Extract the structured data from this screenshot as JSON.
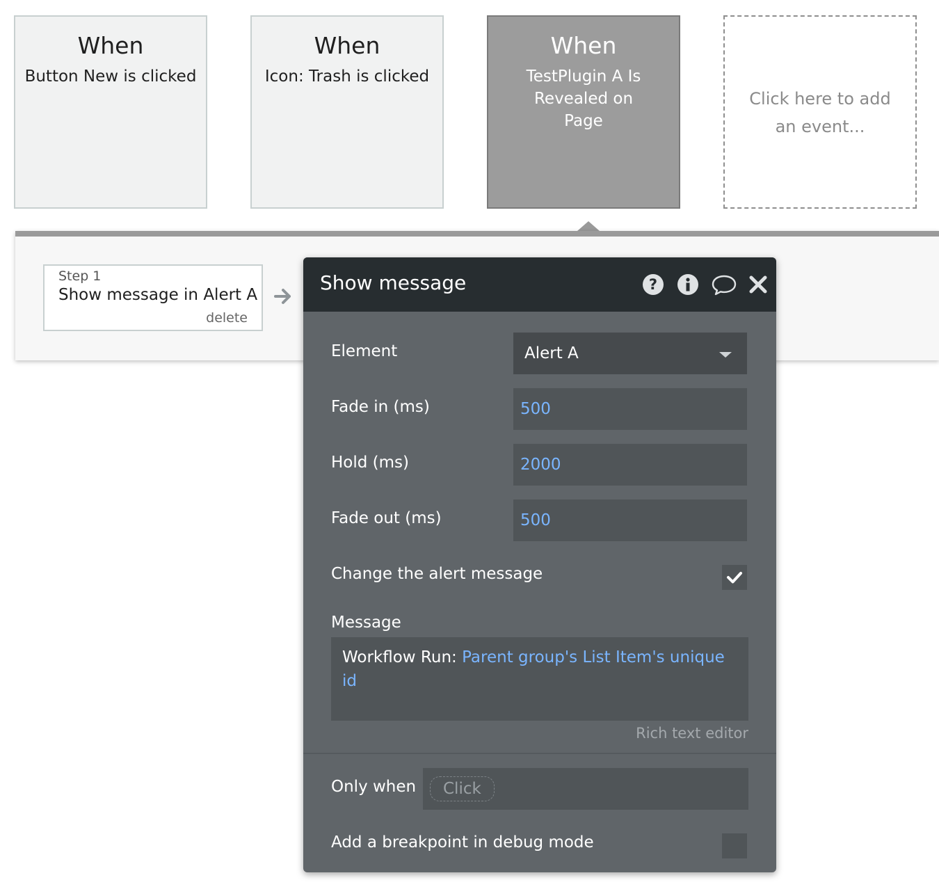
{
  "events": [
    {
      "when": "When",
      "description": "Button New is clicked"
    },
    {
      "when": "When",
      "description": "Icon: Trash is clicked"
    },
    {
      "when": "When",
      "description": "TestPlugin A Is Revealed on Page",
      "selected": true
    }
  ],
  "add_event_text": "Click here to add an event...",
  "step": {
    "number_label": "Step 1",
    "title": "Show message in Alert A",
    "delete_label": "delete"
  },
  "icons": {
    "step_arrow": "arrow-right-icon",
    "help": "question-circle-icon",
    "info": "info-circle-icon",
    "comment": "speech-bubble-icon",
    "close": "close-icon",
    "dropdown": "caret-down-icon",
    "check": "checkmark-icon"
  },
  "panel": {
    "title": "Show message",
    "element": {
      "label": "Element",
      "value": "Alert A"
    },
    "fade_in": {
      "label": "Fade in (ms)",
      "value": "500"
    },
    "hold": {
      "label": "Hold (ms)",
      "value": "2000"
    },
    "fade_out": {
      "label": "Fade out (ms)",
      "value": "500"
    },
    "change_alert": {
      "label": "Change the alert message",
      "checked": true
    },
    "message": {
      "label": "Message",
      "static_text": "Workflow Run: ",
      "dynamic_text": "Parent group's List Item's unique id"
    },
    "rich_text_link": "Rich text editor",
    "only_when": {
      "label": "Only when",
      "placeholder": "Click"
    },
    "breakpoint": {
      "label": "Add a breakpoint in debug mode",
      "checked": false
    }
  },
  "colors": {
    "panel_bg": "#606569",
    "panel_header": "#272d30",
    "field_bg": "#505558",
    "dynamic_value": "#7ab5ff",
    "selected_event": "#9c9c9c"
  }
}
